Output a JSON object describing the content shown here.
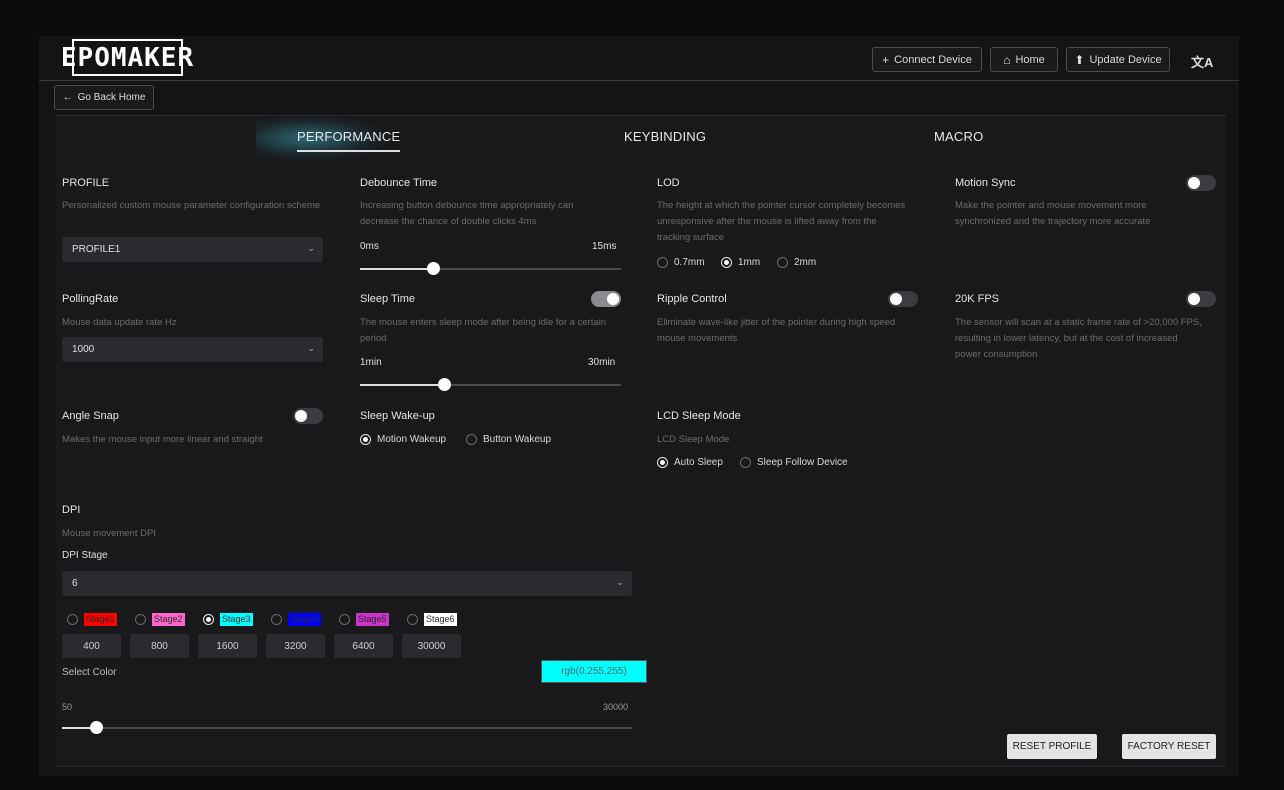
{
  "brand": {
    "logo_text": "EPOMAKER"
  },
  "header": {
    "connect_label": "Connect Device",
    "home_label": "Home",
    "update_label": "Update Device",
    "lang_icon": "translate-icon"
  },
  "back_label": "Go Back Home",
  "tabs": [
    {
      "label": "PERFORMANCE",
      "active": true
    },
    {
      "label": "KEYBINDING",
      "active": false
    },
    {
      "label": "MACRO",
      "active": false
    }
  ],
  "profile": {
    "title": "PROFILE",
    "desc": "Personalized custom mouse parameter configuration scheme",
    "value": "PROFILE1"
  },
  "debounce": {
    "title": "Debounce Time",
    "desc": "Increasing button debounce time appropriately can decrease the chance of double clicks 4ms",
    "min_label": "0ms",
    "max_label": "15ms",
    "value_fraction": 0.28
  },
  "lod": {
    "title": "LOD",
    "desc": "The height at which the pointer cursor completely becomes unresponsive after the mouse is lifted away from the tracking surface",
    "options": [
      "0.7mm",
      "1mm",
      "2mm"
    ],
    "selected": "1mm"
  },
  "motion_sync": {
    "title": "Motion Sync",
    "desc": "Make the pointer and mouse movement more synchronized and the trajectory more accurate",
    "enabled": false
  },
  "polling": {
    "title": "PollingRate",
    "desc": "Mouse data update rate Hz",
    "value": "1000"
  },
  "sleep_time": {
    "title": "Sleep Time",
    "desc": "The mouse enters sleep mode after being idle for a certain period",
    "min_label": "1min",
    "max_label": "30min",
    "value_fraction": 0.32,
    "enabled": true
  },
  "ripple": {
    "title": "Ripple Control",
    "desc": "Eliminate wave-like jitter of the pointer during high speed mouse movements",
    "enabled": false
  },
  "fps20k": {
    "title": "20K FPS",
    "desc": "The sensor will scan at a static frame rate of >20,000 FPS, resulting in lower latency, but at the cost of increased power consumption",
    "enabled": false
  },
  "angle_snap": {
    "title": "Angle Snap",
    "desc": "Makes the mouse input more linear and straight",
    "enabled": false
  },
  "sleep_wakeup": {
    "title": "Sleep Wake-up",
    "options": [
      "Motion Wakeup",
      "Button Wakeup"
    ],
    "selected": "Motion Wakeup"
  },
  "lcd_sleep": {
    "title": "LCD Sleep Mode",
    "desc": "LCD Sleep Mode",
    "options": [
      "Auto Sleep",
      "Sleep Follow Device"
    ],
    "selected": "Auto Sleep"
  },
  "dpi": {
    "title": "DPI",
    "desc": "Mouse movement DPI",
    "stage_label": "DPI Stage",
    "stage_count": "6",
    "stages": [
      {
        "name": "Stage1",
        "value": "400",
        "color": "#ff0000",
        "selected": false
      },
      {
        "name": "Stage2",
        "value": "800",
        "color": "#ff66cc",
        "selected": false
      },
      {
        "name": "Stage3",
        "value": "1600",
        "color": "#00ffff",
        "selected": true
      },
      {
        "name": "Stage4",
        "value": "3200",
        "color": "#0000ff",
        "selected": false
      },
      {
        "name": "Stage5",
        "value": "6400",
        "color": "#cc33cc",
        "selected": false
      },
      {
        "name": "Stage6",
        "value": "30000",
        "color": "#ffffff",
        "selected": false
      }
    ],
    "select_color_label": "Select Color",
    "color_value": "rgb(0,255,255)",
    "range_min": "50",
    "range_max": "30000",
    "value_fraction": 0.06
  },
  "actions": {
    "reset_profile": "RESET PROFILE",
    "factory_reset": "FACTORY RESET"
  }
}
